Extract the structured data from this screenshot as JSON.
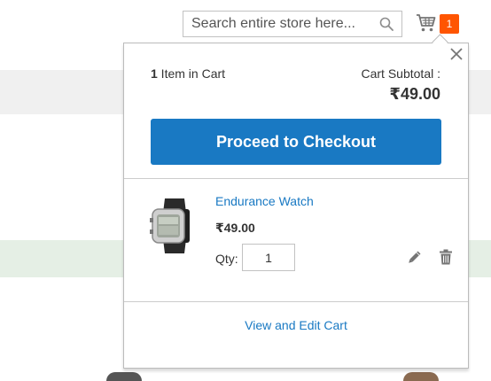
{
  "header": {
    "search": {
      "placeholder": "Search entire store here...",
      "value": ""
    },
    "cart": {
      "counter": "1"
    }
  },
  "minicart": {
    "items_count": "1",
    "items_label": " Item in Cart",
    "subtotal_label": "Cart Subtotal :",
    "subtotal_price": "₹49.00",
    "checkout_label": "Proceed to Checkout",
    "items": [
      {
        "name": "Endurance Watch",
        "price": "₹49.00",
        "qty_label": "Qty:",
        "qty": "1"
      }
    ],
    "view_cart_label": "View and Edit Cart"
  },
  "colors": {
    "accent": "#1979c3",
    "counter": "#ff5501",
    "bg_gray": "#f0f0f0",
    "bg_green": "#e5efe5"
  },
  "icons": [
    "search-icon",
    "cart-icon",
    "close-icon",
    "edit-icon",
    "trash-icon"
  ]
}
